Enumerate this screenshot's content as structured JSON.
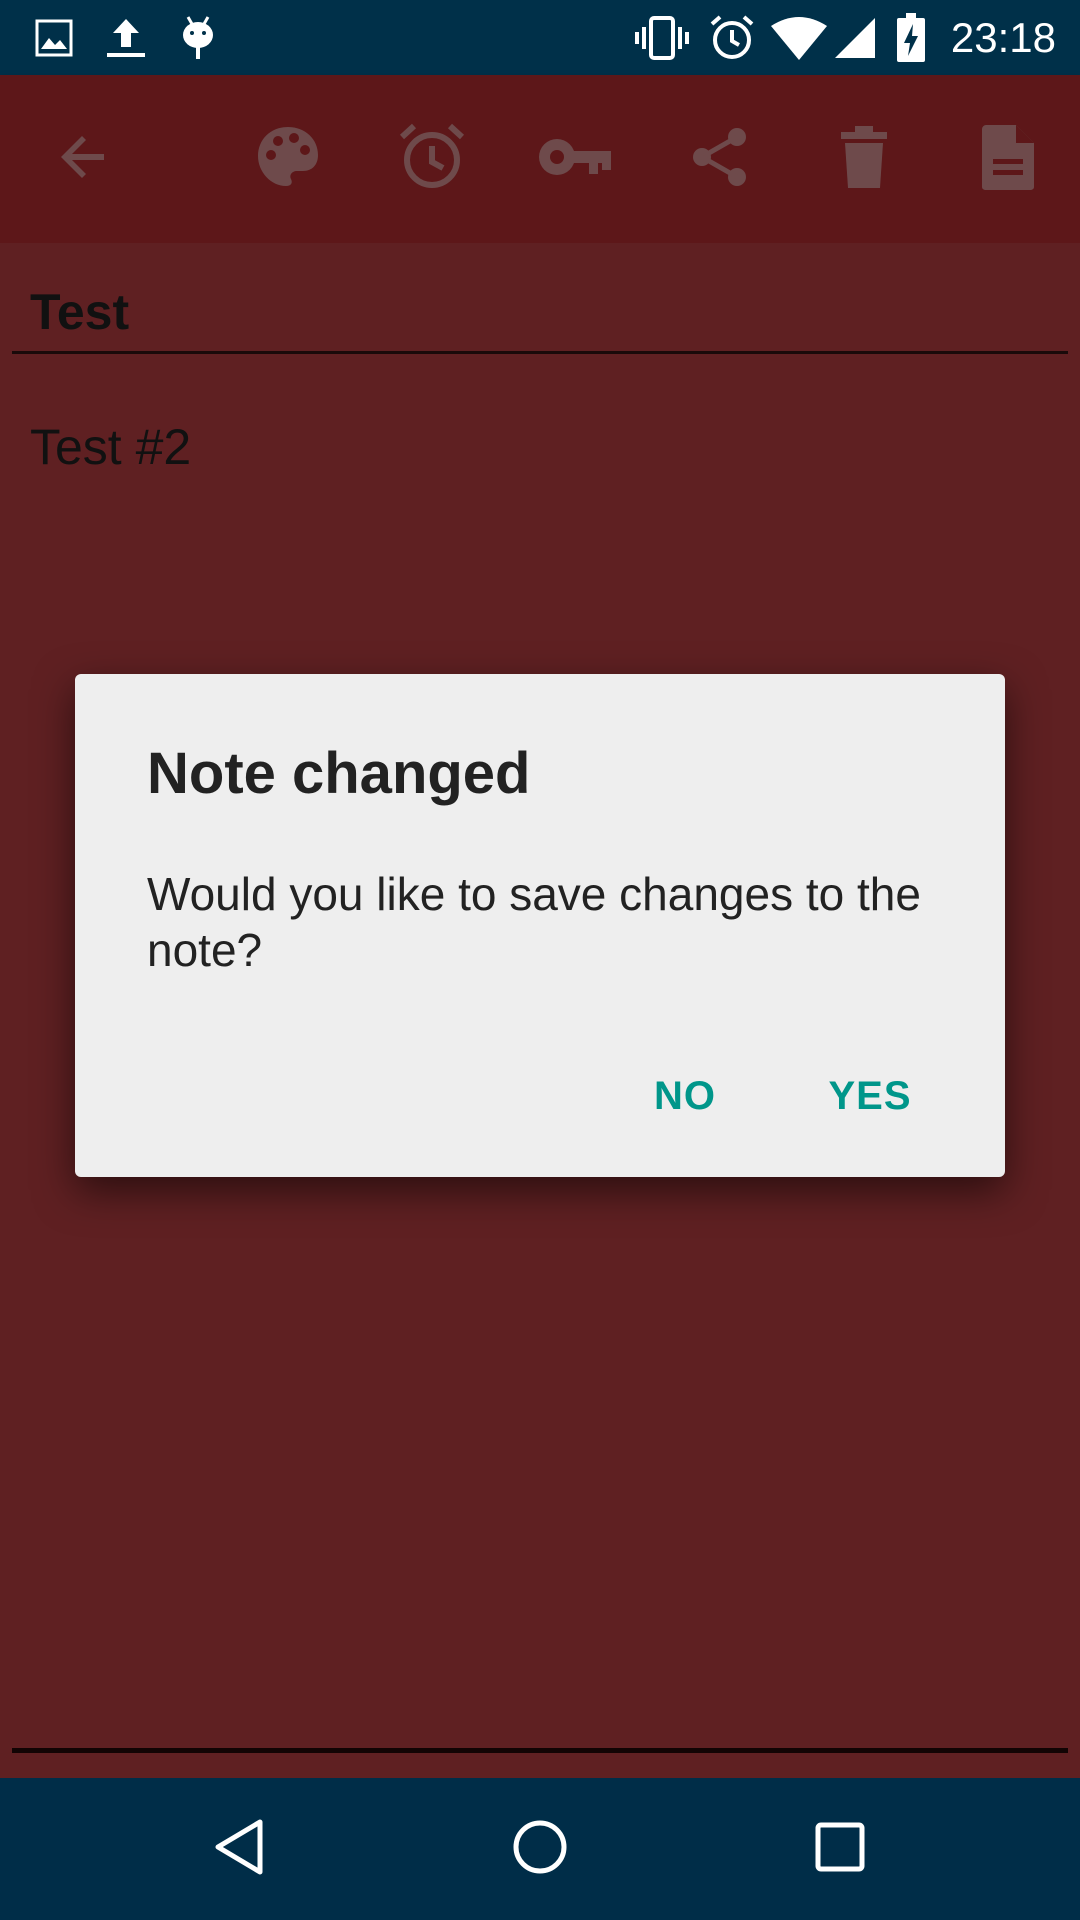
{
  "status_bar": {
    "time": "23:18",
    "left_icons": [
      "image-icon",
      "upload-icon",
      "android-debug-icon"
    ],
    "right_icons": [
      "vibrate-icon",
      "alarm-icon",
      "wifi-icon",
      "cell-signal-icon",
      "battery-charging-icon"
    ]
  },
  "toolbar": {
    "icons": [
      "back-arrow-icon",
      "palette-icon",
      "alarm-icon",
      "key-icon",
      "share-icon",
      "delete-icon",
      "document-icon"
    ]
  },
  "note": {
    "title": "Test",
    "body": "Test #2"
  },
  "dialog": {
    "title": "Note changed",
    "message": "Would you like to save changes to the note?",
    "no_label": "NO",
    "yes_label": "YES"
  },
  "nav_bar": {
    "icons": [
      "nav-back-icon",
      "nav-home-icon",
      "nav-recents-icon"
    ]
  },
  "colors": {
    "status_bar": "#003049",
    "toolbar": "#5d1719",
    "content_bg": "#5f2022",
    "dialog_bg": "#eeeeee",
    "accent": "#00968a",
    "toolbar_icon": "#6e4a4b"
  }
}
